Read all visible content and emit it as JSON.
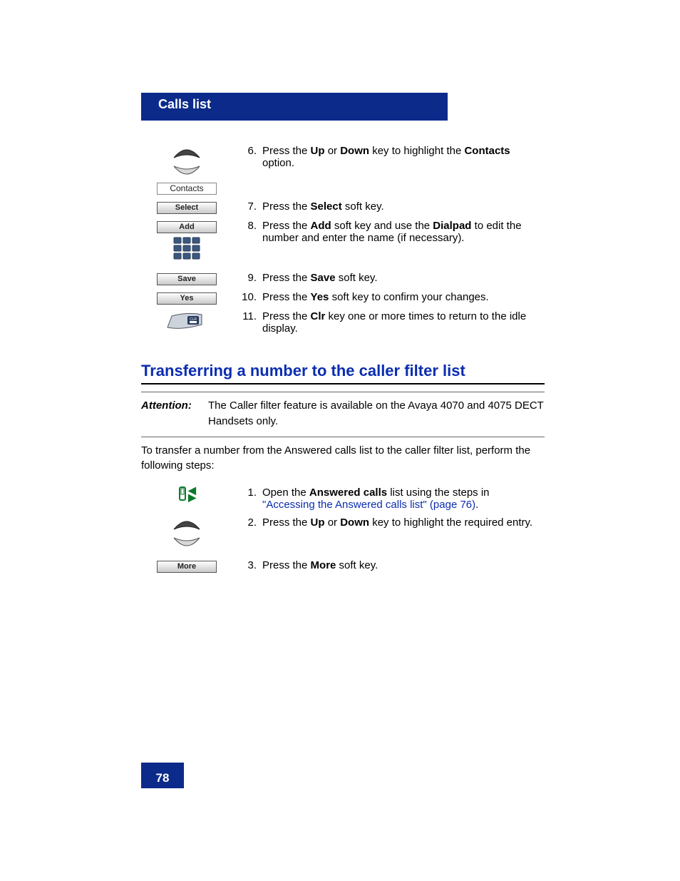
{
  "header": {
    "title": "Calls list"
  },
  "section1": {
    "steps": [
      {
        "num": "6.",
        "t1": "Press the ",
        "bold1": "Up",
        "t2": " or ",
        "bold2": "Down",
        "t3": " key to highlight the ",
        "bold3": "Contacts",
        "t4": " option.",
        "icons": [
          "nav",
          "contacts"
        ]
      },
      {
        "num": "7.",
        "t1": "Press the ",
        "bold1": "Select",
        "t2": " soft key.",
        "icons": [
          "select"
        ]
      },
      {
        "num": "8.",
        "t1": "Press the ",
        "bold1": "Add",
        "t2": " soft key and use the ",
        "bold2": "Dialpad",
        "t3": " to edit the number and enter the name (if necessary).",
        "icons": [
          "add",
          "dialpad"
        ]
      },
      {
        "num": "9.",
        "t1": "Press the ",
        "bold1": "Save",
        "t2": " soft key.",
        "icons": [
          "save"
        ]
      },
      {
        "num": "10.",
        "t1": "Press the ",
        "bold1": "Yes",
        "t2": " soft key to confirm your changes.",
        "icons": [
          "yes"
        ]
      },
      {
        "num": "11.",
        "t1": "Press the ",
        "bold1": "Clr",
        "t2": " key one or more times to return to the idle display.",
        "icons": [
          "clr"
        ]
      }
    ]
  },
  "section2": {
    "title": "Transferring a number to the caller filter list",
    "attn_label": "Attention:",
    "attn_text": "The Caller filter feature is available on the Avaya 4070 and 4075 DECT Handsets only.",
    "intro": "To transfer a number from the Answered calls list to the caller filter list, perform the following steps:",
    "steps": [
      {
        "num": "1.",
        "t1": "Open the ",
        "bold1": "Answered calls",
        "t2": " list using the steps in ",
        "link": "\"Accessing the Answered calls list\" (page 76)",
        "t3": ".",
        "icons": [
          "incoming"
        ]
      },
      {
        "num": "2.",
        "t1": "Press the ",
        "bold1": "Up",
        "t2": " or ",
        "bold2": "Down",
        "t3": " key to highlight the required entry.",
        "icons": [
          "nav"
        ]
      },
      {
        "num": "3.",
        "t1": "Press the ",
        "bold1": "More",
        "t2": " soft key.",
        "icons": [
          "more"
        ]
      }
    ]
  },
  "labels": {
    "contacts": "Contacts",
    "select": "Select",
    "add": "Add",
    "save": "Save",
    "yes": "Yes",
    "more": "More"
  },
  "pageNumber": "78"
}
